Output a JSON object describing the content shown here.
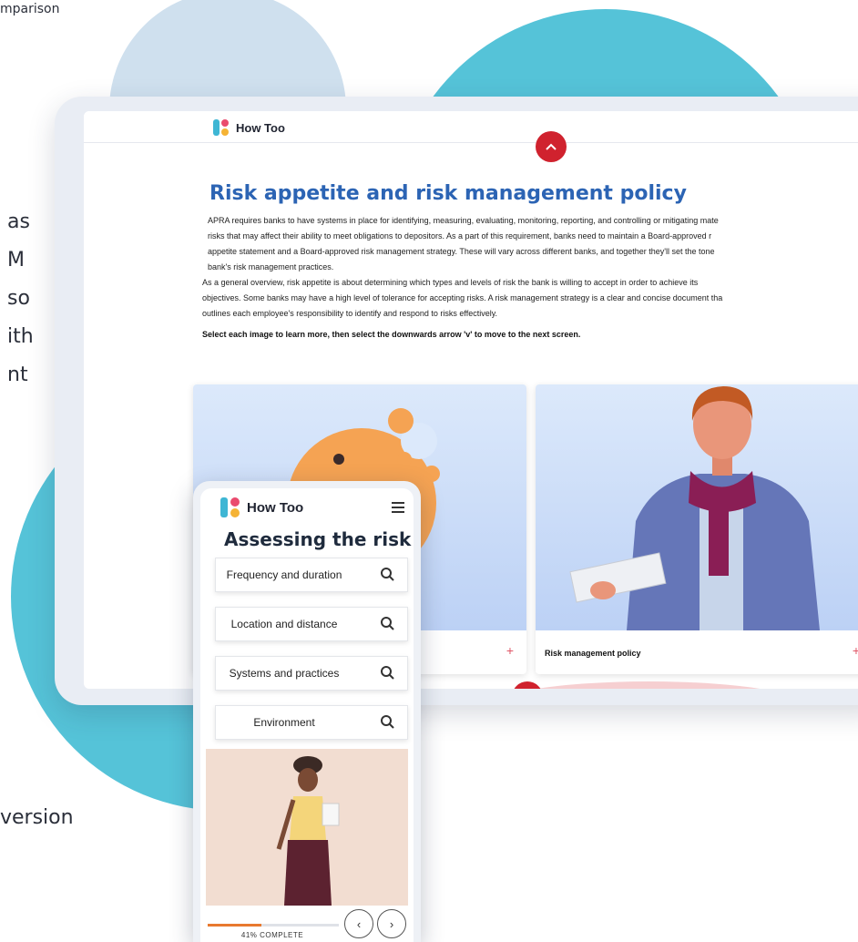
{
  "background_text": {
    "top_fragment": "mparison",
    "lines": [
      "as",
      "M",
      "so",
      "ith",
      "nt"
    ],
    "bottom_fragment": "version"
  },
  "desktop": {
    "brand": "How Too",
    "title": "Risk appetite and risk management policy",
    "paragraph1_lines": [
      "APRA requires banks to have systems in place for identifying, measuring, evaluating, monitoring, reporting, and controlling or mitigating mate",
      "risks that may affect their ability to meet obligations to depositors. As a part of this requirement, banks need to maintain a Board-approved r",
      "appetite statement and a Board-approved risk management strategy. These will vary across different banks, and together they'll set the tone",
      "bank's risk management practices."
    ],
    "paragraph2_lines": [
      "As a general overview, risk appetite is about determining which types and levels of risk the bank is willing to accept in order to achieve its",
      "objectives. Some banks may have a high level of tolerance for accepting risks. A risk management strategy is a clear and concise document tha",
      "outlines each employee's responsibility to identify and respond to risks effectively."
    ],
    "instruction": "Select each image to learn more, then select the downwards arrow 'v' to move to the next screen.",
    "cards": [
      {
        "label": "",
        "plus": "+"
      },
      {
        "label": "Risk management policy",
        "plus": "+"
      }
    ],
    "up_icon": "chevron-up-icon",
    "down_icon": "chevron-down-icon"
  },
  "mobile": {
    "brand": "How Too",
    "menu_icon": "hamburger-menu-icon",
    "title": "Assessing the risk",
    "items": [
      {
        "label": "Frequency and duration"
      },
      {
        "label": "Location and distance"
      },
      {
        "label": "Systems and practices"
      },
      {
        "label": "Environment"
      }
    ],
    "progress_percent": 41,
    "progress_label": "41% COMPLETE",
    "prev": "‹",
    "next": "›"
  },
  "colors": {
    "teal_blob": "#55c3d8",
    "pale_blob": "#cfe0ee",
    "title_blue": "#2c64b4",
    "accent_red": "#d0222e",
    "progress_orange": "#e8792f"
  }
}
